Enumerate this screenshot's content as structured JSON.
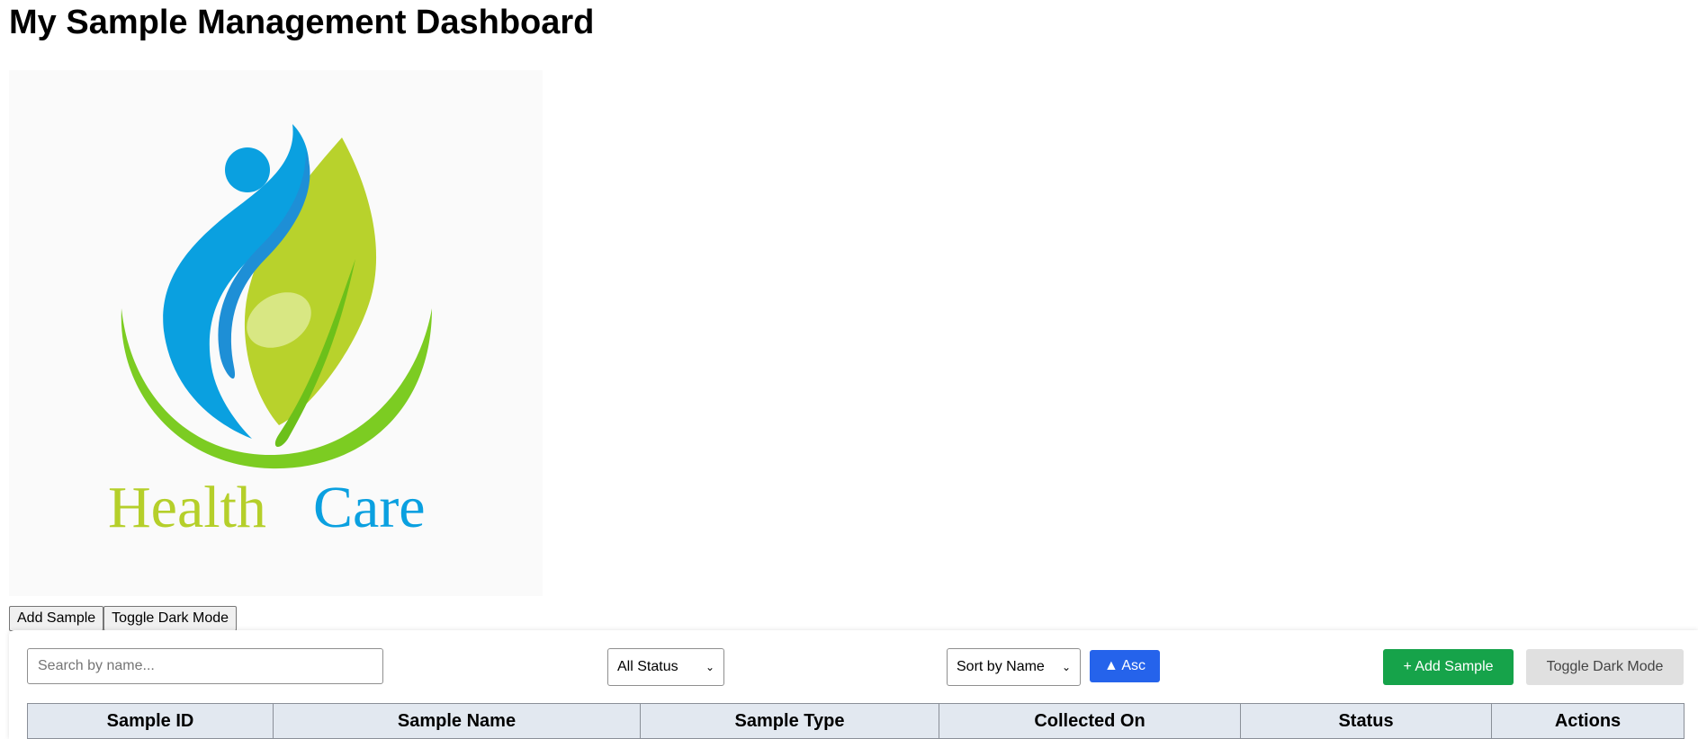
{
  "page": {
    "title": "My Sample Management Dashboard"
  },
  "logo": {
    "text_health": "Health",
    "text_care": "Care",
    "colors": {
      "blue": "#0aa0e0",
      "green": "#a8c928",
      "dark_green": "#6cc01a"
    }
  },
  "top_buttons": {
    "add_label": "Add Sample",
    "toggle_label": "Toggle Dark Mode"
  },
  "toolbar": {
    "search_placeholder": "Search by name...",
    "status_filter": "All Status",
    "sort_by": "Sort by Name",
    "sort_direction": "▲ Asc",
    "add_label": "+ Add Sample",
    "toggle_label": "Toggle Dark Mode",
    "colors": {
      "primary": "#2563eb",
      "success": "#16a34a",
      "neutral": "#e0e0e0"
    }
  },
  "table": {
    "columns": [
      "Sample ID",
      "Sample Name",
      "Sample Type",
      "Collected On",
      "Status",
      "Actions"
    ]
  }
}
